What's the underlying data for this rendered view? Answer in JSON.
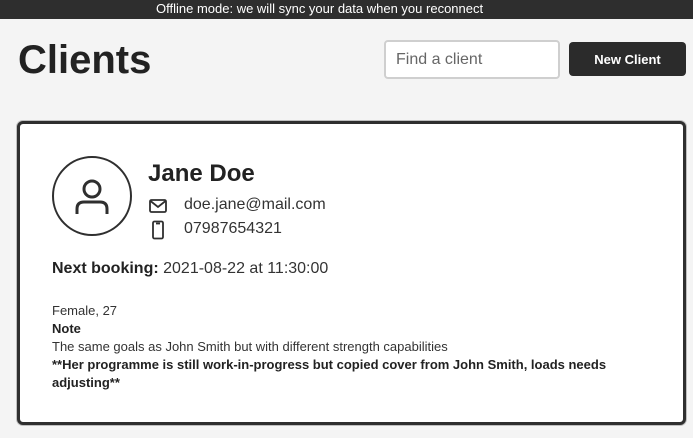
{
  "banner": {
    "offline_message": "Offline mode: we will sync your data when you reconnect"
  },
  "header": {
    "title": "Clients",
    "search_placeholder": "Find a client",
    "new_client_label": "New Client"
  },
  "client": {
    "name": "Jane Doe",
    "email": "doe.jane@mail.com",
    "phone": "07987654321",
    "next_booking_label": "Next booking:",
    "next_booking_value": "2021-08-22 at 11:30:00",
    "demographics": "Female, 27",
    "note_heading": "Note",
    "note_text": "The same goals as John Smith but with different strength capabilities",
    "note_emphasis": "**Her programme is still work-in-progress but copied cover from John Smith, loads needs adjusting**"
  },
  "icons": {
    "avatar": "user-icon",
    "email": "mail-icon",
    "phone": "phone-icon"
  },
  "colors": {
    "banner_bg": "#2e2e2e",
    "button_bg": "#2b2b2b",
    "card_border": "#2f2f2f"
  }
}
